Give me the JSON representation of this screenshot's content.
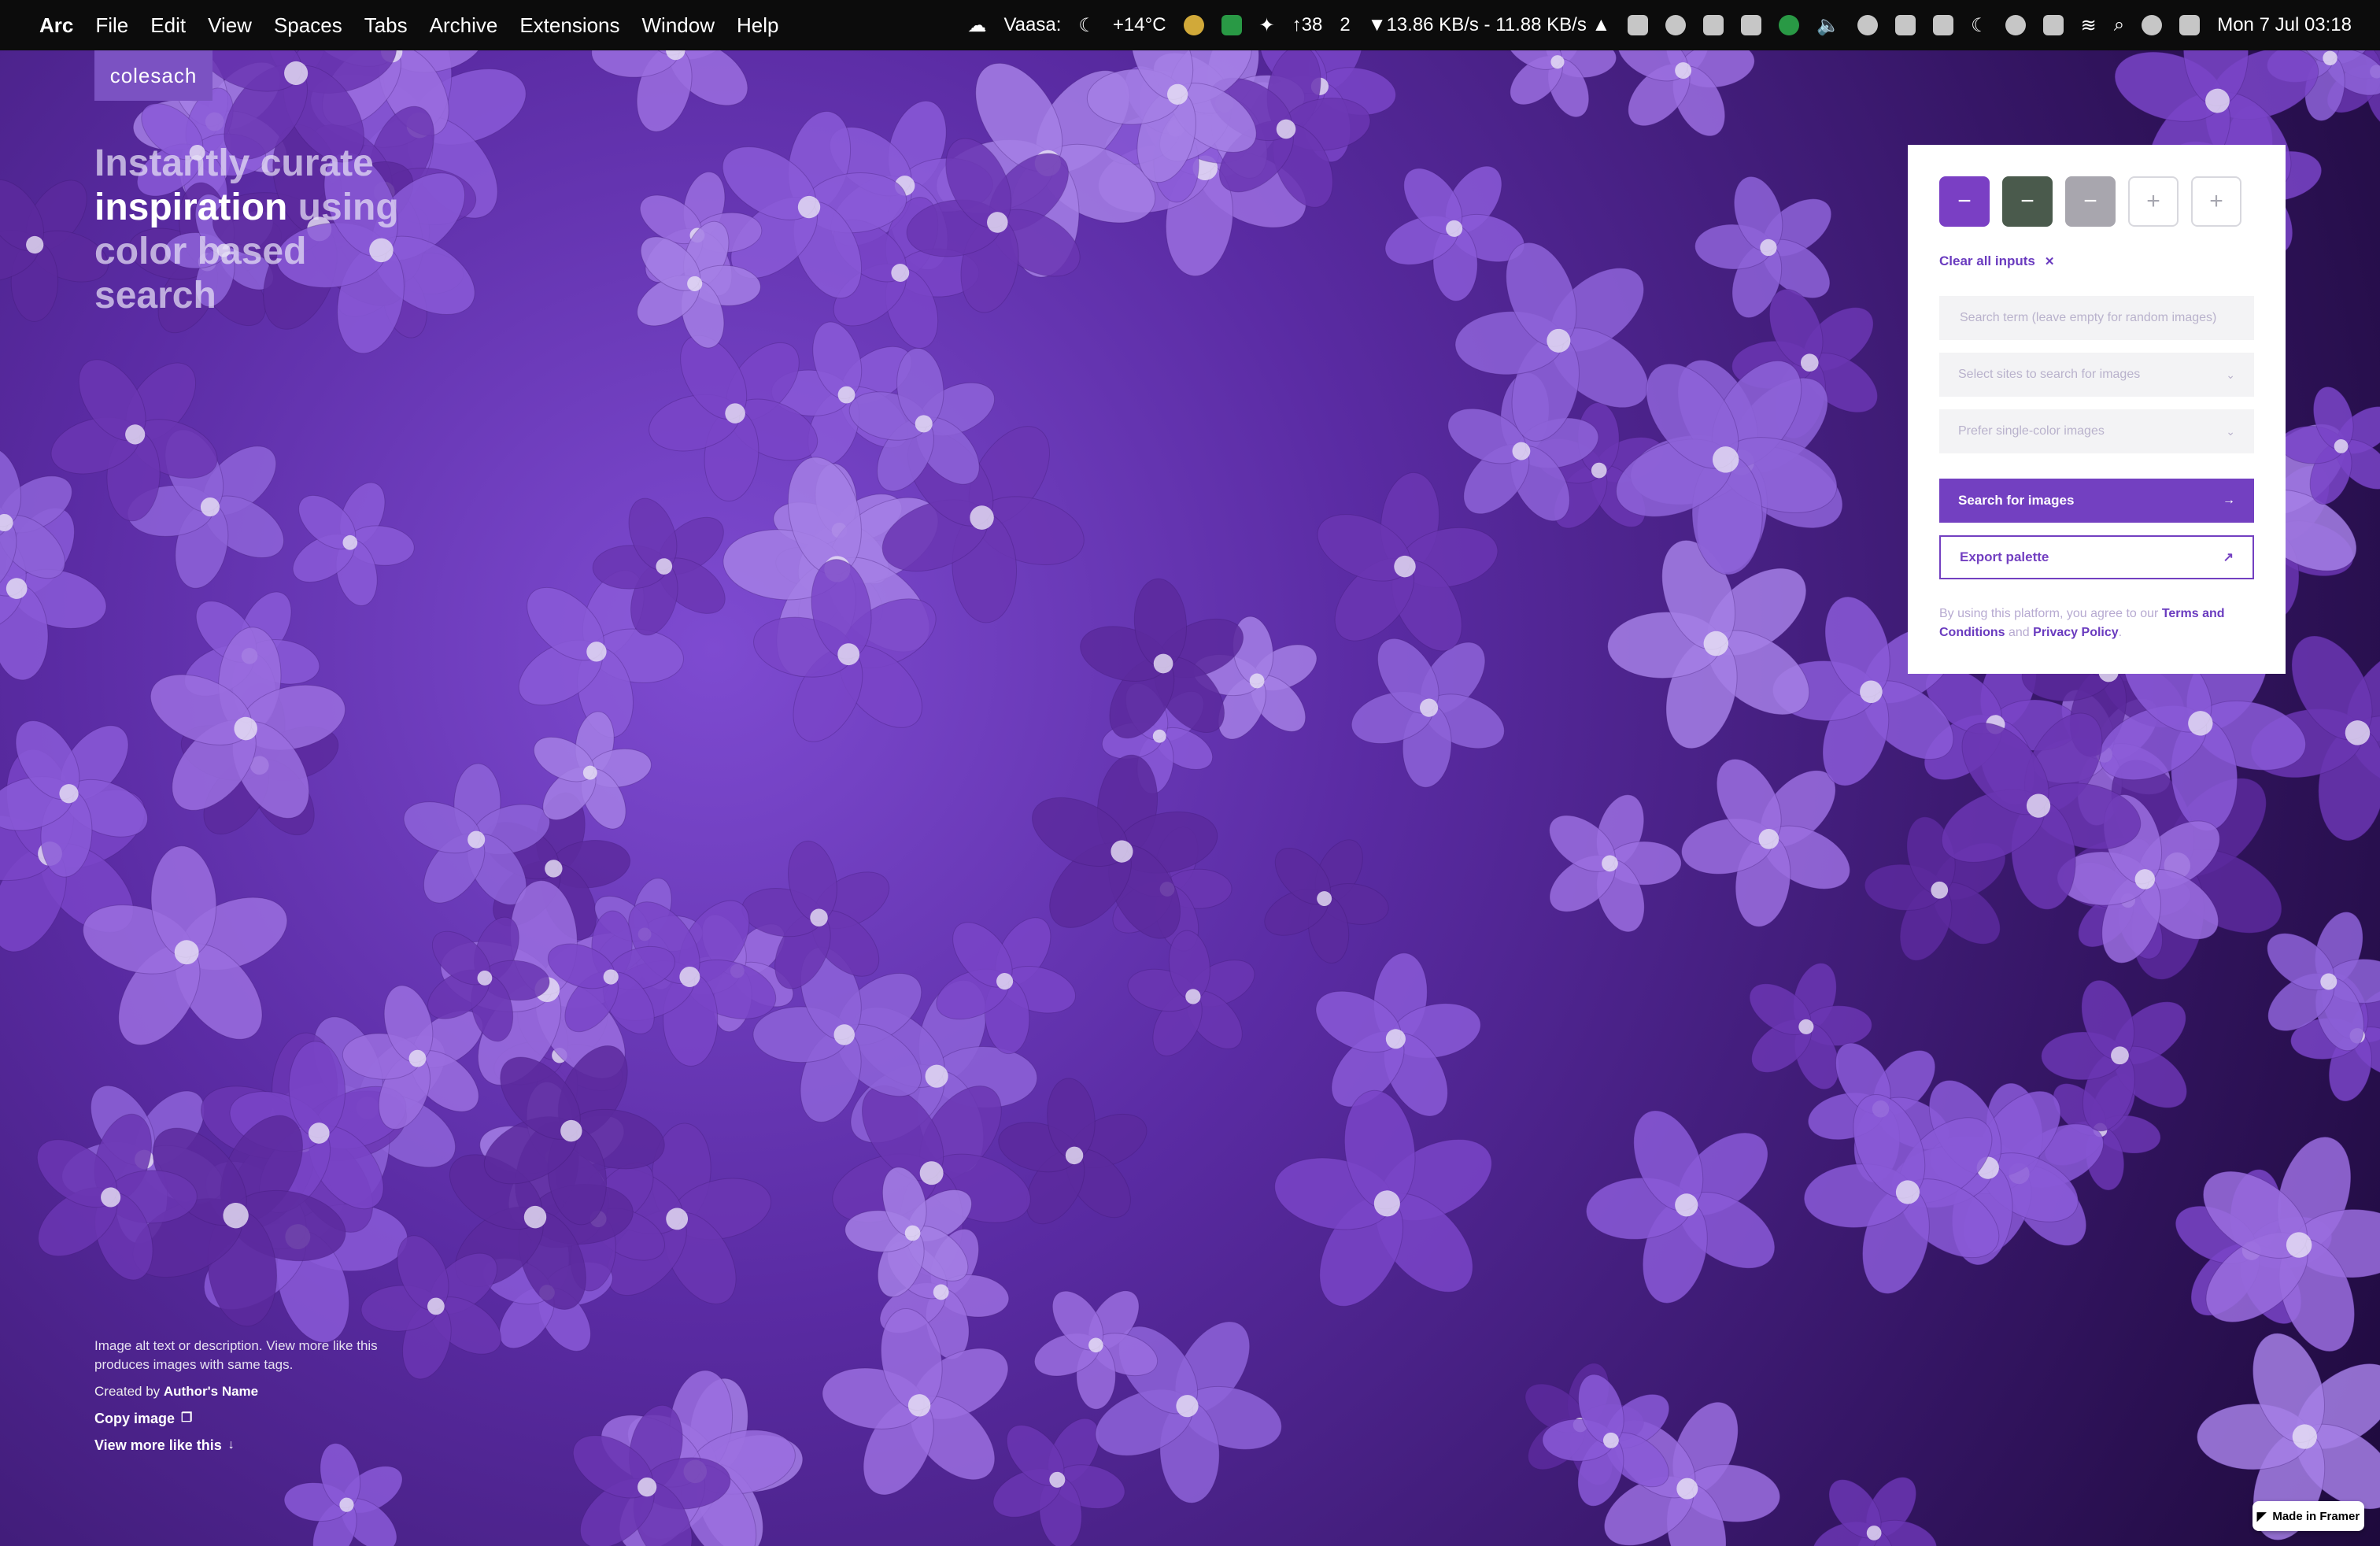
{
  "menubar": {
    "apple": "",
    "app": "Arc",
    "menus": [
      "File",
      "Edit",
      "View",
      "Spaces",
      "Tabs",
      "Archive",
      "Extensions",
      "Window",
      "Help"
    ],
    "weather_location": "Vaasa:",
    "temperature": "+14°C",
    "updates_count": "↑38",
    "notifications_count": "2",
    "network_speed": "▼13.86 KB/s - 11.88 KB/s ▲",
    "datetime": "Mon 7 Jul 03:18"
  },
  "site": {
    "logo_text": "colesach",
    "hero_line1": "Instantly curate",
    "hero_line2_highlight": "inspiration",
    "hero_line2_rest": " using",
    "hero_line3": "color based",
    "hero_line4": "search"
  },
  "image_info": {
    "description": "Image alt text or description. View more like this produces images with same tags.",
    "created_prefix": "Created by ",
    "author": "Author's Name",
    "copy_label": "Copy image",
    "view_more_label": "View more like this"
  },
  "panel": {
    "swatches": [
      {
        "color": "#7a3fc4",
        "symbol": "−"
      },
      {
        "color": "#4a5a4c",
        "symbol": "−"
      },
      {
        "color": "#a8a6ae",
        "symbol": "−"
      },
      {
        "color": "#ffffff",
        "symbol": "+"
      },
      {
        "color": "#ffffff",
        "symbol": "+"
      }
    ],
    "clear_label": "Clear all inputs",
    "search_placeholder": "Search term (leave empty for random images)",
    "sites_placeholder": "Select sites to search for images",
    "single_color_placeholder": "Prefer single-color images",
    "search_button": "Search for images",
    "export_button": "Export palette",
    "terms_prefix": "By using this platform, you agree to our ",
    "terms_link": "Terms and Conditions",
    "terms_and": " and ",
    "privacy_link": "Privacy Policy",
    "terms_suffix": "."
  },
  "framer_badge": "Made in Framer",
  "colors": {
    "accent": "#7340c1",
    "menubar": "#0c0c0c"
  }
}
